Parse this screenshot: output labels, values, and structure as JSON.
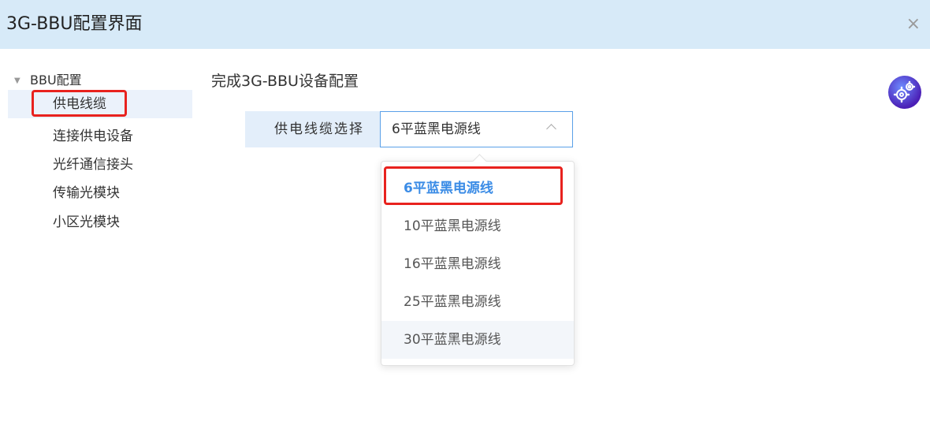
{
  "window": {
    "title": "3G-BBU配置界面",
    "close_label": "×"
  },
  "sidebar": {
    "root": "BBU配置",
    "items": [
      {
        "label": "供电线缆",
        "selected": true
      },
      {
        "label": "连接供电设备"
      },
      {
        "label": "光纤通信接头"
      },
      {
        "label": "传输光模块"
      },
      {
        "label": "小区光模块"
      }
    ]
  },
  "main": {
    "title": "完成3G-BBU设备配置",
    "form": {
      "label": "供电线缆选择",
      "value": "6平蓝黑电源线",
      "options": [
        "6平蓝黑电源线",
        "10平蓝黑电源线",
        "16平蓝黑电源线",
        "25平蓝黑电源线",
        "30平蓝黑电源线"
      ]
    }
  },
  "colors": {
    "accent": "#3b8ce6",
    "annotation": "#e8221e",
    "titlebar": "#d7eaf8"
  },
  "icons": {
    "close": "close-icon",
    "settings": "gear-icon",
    "caret": "caret-down-icon",
    "chevron": "chevron-up-icon"
  }
}
